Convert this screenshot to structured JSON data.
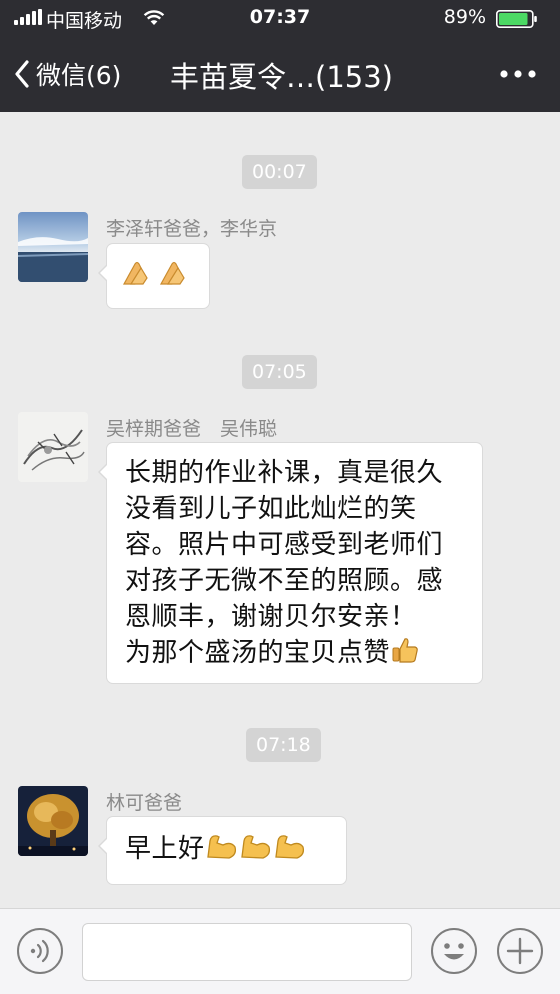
{
  "status_bar": {
    "carrier": "中国移动",
    "time": "07:37",
    "battery_percent": "89%",
    "battery_level": 0.89,
    "icons": [
      "signal-icon",
      "wifi-icon",
      "battery-icon"
    ]
  },
  "nav": {
    "back_label": "微信(6)",
    "title": "丰苗夏令…(153)",
    "icons": [
      "back-chevron-icon",
      "more-icon"
    ]
  },
  "messages": [
    {
      "time": "00:07",
      "sender": "李泽轩爸爸，李华京",
      "text": "",
      "emoji": [
        "clapping-hands-emoji",
        "clapping-hands-emoji"
      ]
    },
    {
      "time": "07:05",
      "sender": "吴梓期爸爸　吴伟聪",
      "lines": [
        "长期的作业补课，真是很久",
        "没看到儿子如此灿烂的笑",
        "容。照片中可感受到老师们",
        "对孩子无微不至的照顾。感",
        "恩顺丰，谢谢贝尔安亲！",
        "为那个盛汤的宝贝点赞"
      ],
      "emoji": [
        "thumbs-up-emoji"
      ]
    },
    {
      "time": "07:18",
      "sender": "林可爸爸",
      "text": "早上好",
      "emoji": [
        "flexed-biceps-emoji",
        "flexed-biceps-emoji",
        "flexed-biceps-emoji"
      ]
    }
  ],
  "input_bar": {
    "icons": [
      "voice-icon",
      "emoji-face-icon",
      "plus-icon"
    ],
    "placeholder": ""
  },
  "colors": {
    "top_bar": "#2d2d32",
    "chat_background": "#ebebeb",
    "timestamp_pill": "#d4d4d4",
    "sender_name": "#8a8a8a",
    "battery_fill": "#4cd964"
  }
}
